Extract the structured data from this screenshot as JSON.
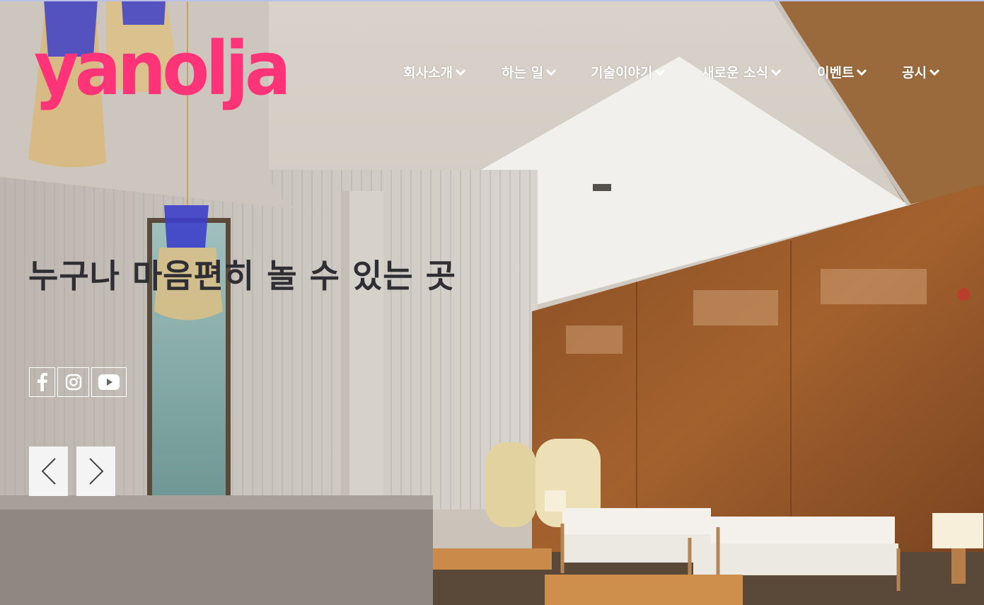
{
  "brand": {
    "logo_text": "yanolja",
    "brand_color": "#ff3478"
  },
  "nav": {
    "items": [
      {
        "label": "회사소개"
      },
      {
        "label": "하는 일"
      },
      {
        "label": "기술이야기"
      },
      {
        "label": "새로운 소식"
      },
      {
        "label": "이벤트"
      },
      {
        "label": "공시"
      }
    ]
  },
  "hero": {
    "headline": "누구나 마음편히 놀 수 있는 곳",
    "image": "hotel lobby with hanging woven lamps, white sofas and wooden wall panels"
  },
  "social": {
    "icons": [
      "facebook-icon",
      "instagram-icon",
      "youtube-icon"
    ]
  },
  "slider": {
    "prev_icon": "chevron-left-icon",
    "next_icon": "chevron-right-icon"
  },
  "colors": {
    "nav_text": "#ffffff",
    "headline": "#2f2f33",
    "arrow_bg": "#f4f4f4"
  }
}
